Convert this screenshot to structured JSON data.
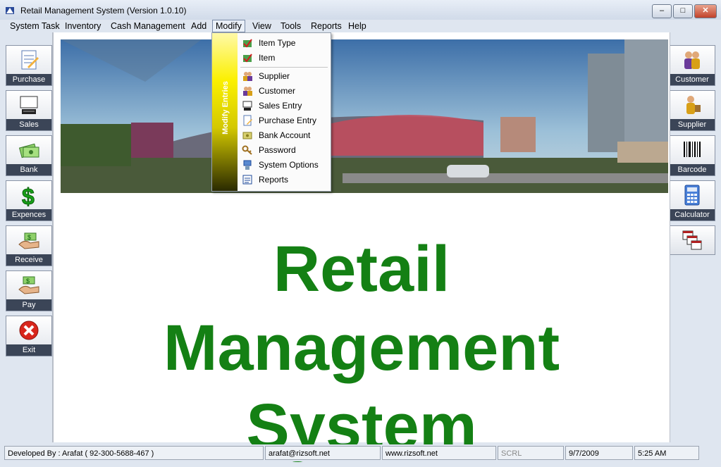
{
  "window": {
    "title": "Retail Management System (Version 1.0.10)",
    "minimize": "–",
    "maximize": "□",
    "close": "✕"
  },
  "menubar": [
    "System Task",
    "Inventory",
    "Cash Management",
    "Add",
    "Modify",
    "View",
    "Tools",
    "Reports",
    "Help"
  ],
  "modify_menu": {
    "side_label": "Modify Entries",
    "items": [
      {
        "label": "Item Type",
        "icon": "item-type-icon"
      },
      {
        "label": "Item",
        "icon": "item-icon"
      },
      {
        "label": "Supplier",
        "icon": "supplier-icon"
      },
      {
        "label": "Customer",
        "icon": "customer-icon"
      },
      {
        "label": "Sales Entry",
        "icon": "sales-entry-icon"
      },
      {
        "label": "Purchase Entry",
        "icon": "purchase-entry-icon"
      },
      {
        "label": "Bank Account",
        "icon": "bank-account-icon"
      },
      {
        "label": "Password",
        "icon": "password-icon"
      },
      {
        "label": "System Options",
        "icon": "system-options-icon"
      },
      {
        "label": "Reports",
        "icon": "reports-icon"
      }
    ]
  },
  "left_buttons": [
    {
      "label": "Purchase",
      "icon": "purchase-icon"
    },
    {
      "label": "Sales",
      "icon": "sales-icon"
    },
    {
      "label": "Bank",
      "icon": "bank-icon"
    },
    {
      "label": "Expences",
      "icon": "expences-icon"
    },
    {
      "label": "Receive",
      "icon": "receive-icon"
    },
    {
      "label": "Pay",
      "icon": "pay-icon"
    },
    {
      "label": "Exit",
      "icon": "exit-icon"
    }
  ],
  "right_buttons": [
    {
      "label": "Customer",
      "icon": "customer-icon"
    },
    {
      "label": "Supplier",
      "icon": "supplier-icon"
    },
    {
      "label": "Barcode",
      "icon": "barcode-icon"
    },
    {
      "label": "Calculator",
      "icon": "calculator-icon"
    },
    {
      "label": "",
      "icon": "windows-icon"
    }
  ],
  "main": {
    "line1": "Retail",
    "line2": "Management",
    "line3": "System"
  },
  "status": {
    "developer": "Developed By : Arafat ( 92-300-5688-467 )",
    "email": "arafat@rizsoft.net",
    "website": "www.rizsoft.net",
    "scrl": "SCRL",
    "date": "9/7/2009",
    "time": "5:25 AM"
  },
  "colors": {
    "title_green": "#148014",
    "label_bar": "#3b4557"
  }
}
